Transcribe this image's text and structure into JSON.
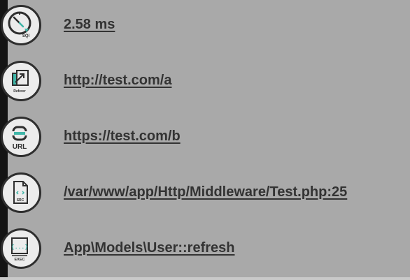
{
  "items": [
    {
      "icon": "sql-timer-icon",
      "icon_text": "SQl",
      "label": "2.58 ms"
    },
    {
      "icon": "referer-icon",
      "icon_text": "Referer",
      "label": "http://test.com/a"
    },
    {
      "icon": "url-link-icon",
      "icon_text": "URL",
      "label": "https://test.com/b"
    },
    {
      "icon": "source-file-icon",
      "icon_text": "SRC",
      "label": "/var/www/app/Http/Middleware/Test.php:25"
    },
    {
      "icon": "exec-icon",
      "icon_text": "EXEC",
      "label": "App\\Models\\User::refresh"
    }
  ],
  "colors": {
    "background": "#a9a9a9",
    "accent": "#3fb6a8",
    "text": "#333333",
    "left_bar": "#141414"
  }
}
